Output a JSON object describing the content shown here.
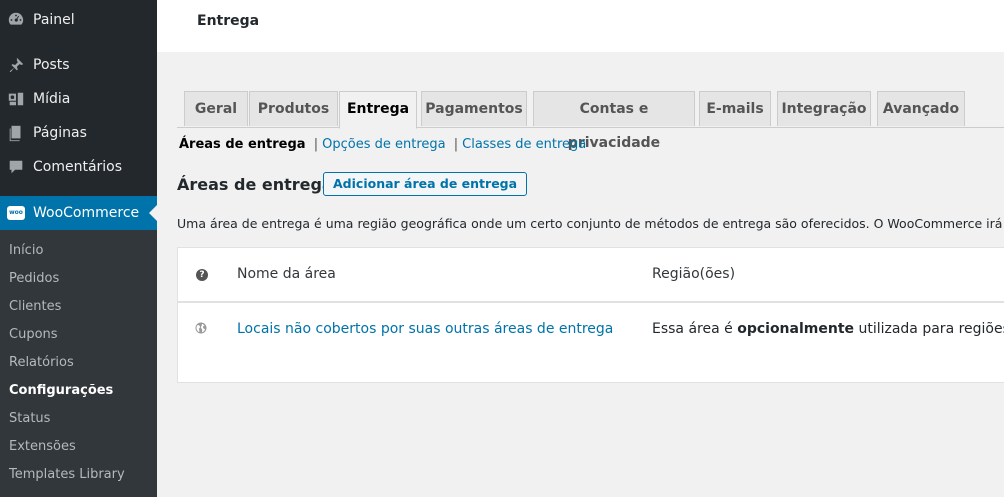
{
  "sidebar": {
    "top_items": [
      {
        "label": "Painel",
        "icon": "dashboard-icon"
      },
      {
        "label": "Posts",
        "icon": "pin-icon"
      },
      {
        "label": "Mídia",
        "icon": "media-icon"
      },
      {
        "label": "Páginas",
        "icon": "page-icon"
      },
      {
        "label": "Comentários",
        "icon": "comment-icon"
      }
    ],
    "woocommerce": {
      "label": "WooCommerce",
      "icon_text": "woo"
    },
    "submenu": [
      "Início",
      "Pedidos",
      "Clientes",
      "Cupons",
      "Relatórios",
      "Configurações",
      "Status",
      "Extensões",
      "Templates Library"
    ],
    "current_submenu": "Configurações"
  },
  "header": {
    "title": "Entrega"
  },
  "tabs": [
    "Geral",
    "Produtos",
    "Entrega",
    "Pagamentos",
    "Contas e privacidade",
    "E-mails",
    "Integração",
    "Avançado"
  ],
  "active_tab": "Entrega",
  "subnav": {
    "current": "Áreas de entrega",
    "links": [
      "Opções de entrega",
      "Classes de entrega"
    ],
    "separator": "|"
  },
  "main": {
    "heading": "Áreas de entrega",
    "add_button": "Adicionar área de entrega",
    "description": "Uma área de entrega é uma região geográfica onde um certo conjunto de métodos de entrega são oferecidos. O WooCommerce irá escolher um"
  },
  "table": {
    "help_icon_text": "?",
    "columns": [
      "Nome da área",
      "Região(ões)"
    ],
    "row": {
      "name": "Locais não cobertos por suas outras áreas de entrega",
      "region_prefix": "Essa área é ",
      "region_bold": "opcionalmente",
      "region_suffix": " utilizada para regiões que não estão incluídas em nenhuma outra área de entrega."
    }
  },
  "colors": {
    "accent": "#0073aa",
    "sidebar_bg": "#23282d",
    "submenu_bg": "#32373c"
  }
}
